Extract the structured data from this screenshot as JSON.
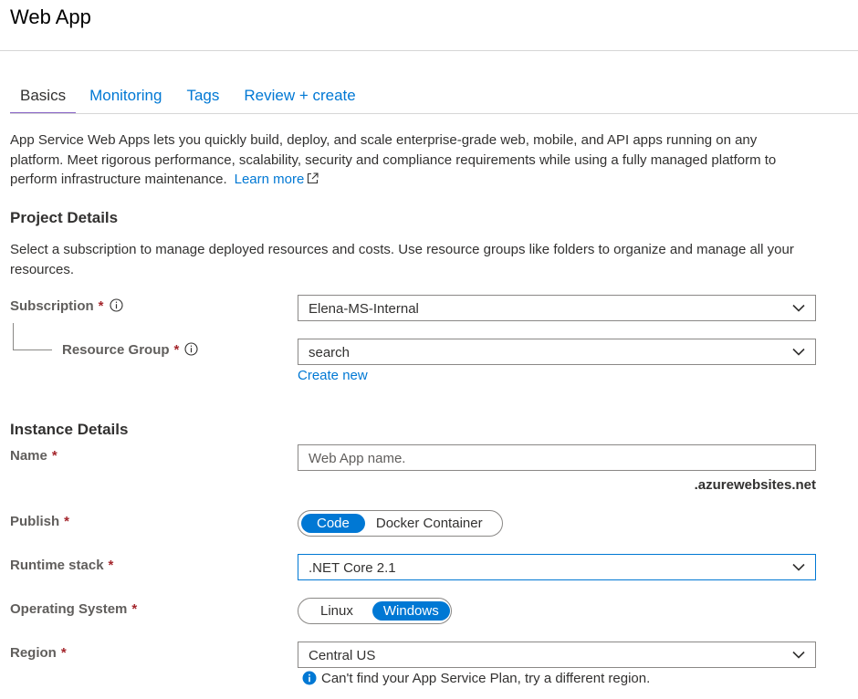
{
  "page": {
    "title": "Web App"
  },
  "tabs": [
    {
      "label": "Basics",
      "active": true
    },
    {
      "label": "Monitoring"
    },
    {
      "label": "Tags"
    },
    {
      "label": "Review + create"
    }
  ],
  "intro": {
    "text": "App Service Web Apps lets you quickly build, deploy, and scale enterprise-grade web, mobile, and API apps running on any platform. Meet rigorous performance, scalability, security and compliance requirements while using a fully managed platform to perform infrastructure maintenance.",
    "learn_more": "Learn more"
  },
  "project": {
    "heading": "Project Details",
    "description": "Select a subscription to manage deployed resources and costs. Use resource groups like folders to organize and manage all your resources.",
    "subscription": {
      "label": "Subscription",
      "required": "*",
      "value": "Elena-MS-Internal"
    },
    "resource_group": {
      "label": "Resource Group",
      "required": "*",
      "value": "search",
      "create_new": "Create new"
    }
  },
  "instance": {
    "heading": "Instance Details",
    "name": {
      "label": "Name",
      "required": "*",
      "placeholder": "Web App name.",
      "suffix": ".azurewebsites.net"
    },
    "publish": {
      "label": "Publish",
      "required": "*",
      "options": [
        "Code",
        "Docker Container"
      ],
      "selected": "Code"
    },
    "runtime": {
      "label": "Runtime stack",
      "required": "*",
      "value": ".NET Core 2.1"
    },
    "os": {
      "label": "Operating System",
      "required": "*",
      "options": [
        "Linux",
        "Windows"
      ],
      "selected": "Windows"
    },
    "region": {
      "label": "Region",
      "required": "*",
      "value": "Central US",
      "hint": "Can't find your App Service Plan, try a different region."
    }
  },
  "colors": {
    "accent": "#0078d4",
    "tab_underline": "#8661c5",
    "required": "#a4262c"
  },
  "icons": {
    "info": "info-circle-icon",
    "dropdown": "chevron-down-icon",
    "external": "external-link-icon",
    "hint": "info-filled-icon"
  }
}
